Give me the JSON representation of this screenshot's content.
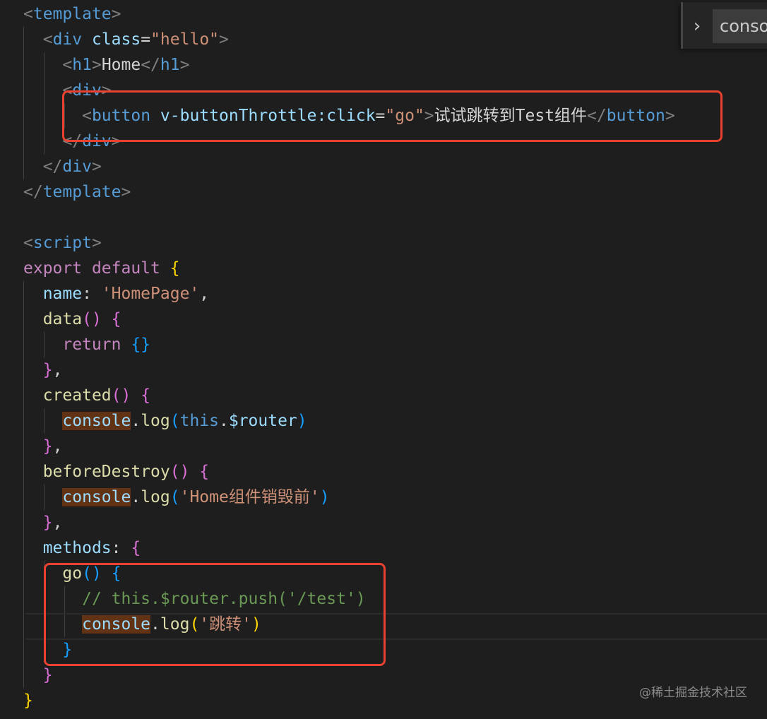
{
  "code": {
    "l1": {
      "tag": "template"
    },
    "l2": {
      "tag": "div",
      "attr": "class",
      "eq": "=",
      "val": "\"hello\""
    },
    "l3": {
      "tag": "h1",
      "text": "Home"
    },
    "l4": {
      "tag": "div"
    },
    "l5": {
      "tag": "button",
      "directive": "v-buttonThrottle:click",
      "eq": "=",
      "val": "\"go\"",
      "text": "试试跳转到Test组件"
    },
    "l6": {
      "tag": "div"
    },
    "l7": {
      "tag": "div"
    },
    "l8": {
      "tag": "template"
    },
    "l10": {
      "tag": "script"
    },
    "l11": {
      "kw1": "export",
      "kw2": "default"
    },
    "l12": {
      "key": "name",
      "val": "'HomePage'"
    },
    "l13": {
      "fn": "data"
    },
    "l14": {
      "kw": "return"
    },
    "l16": {
      "fn": "created"
    },
    "l17": {
      "obj": "console",
      "method": "log",
      "this": "this",
      "prop": "$router"
    },
    "l19": {
      "fn": "beforeDestroy"
    },
    "l20": {
      "obj": "console",
      "method": "log",
      "str": "'Home组件销毁前'"
    },
    "l22": {
      "key": "methods"
    },
    "l23": {
      "fn": "go"
    },
    "l24": {
      "comment": "// this.$router.push('/test')"
    },
    "l25": {
      "obj": "console",
      "method": "log",
      "str": "'跳转'"
    }
  },
  "find_widget": {
    "value": "conso",
    "toggle_icon": "chevron-right"
  },
  "watermark": "@稀土掘金技术社区",
  "colors": {
    "background": "#1e1e1e",
    "highlight_box": "#e8412f",
    "match_highlight": "#613214"
  }
}
